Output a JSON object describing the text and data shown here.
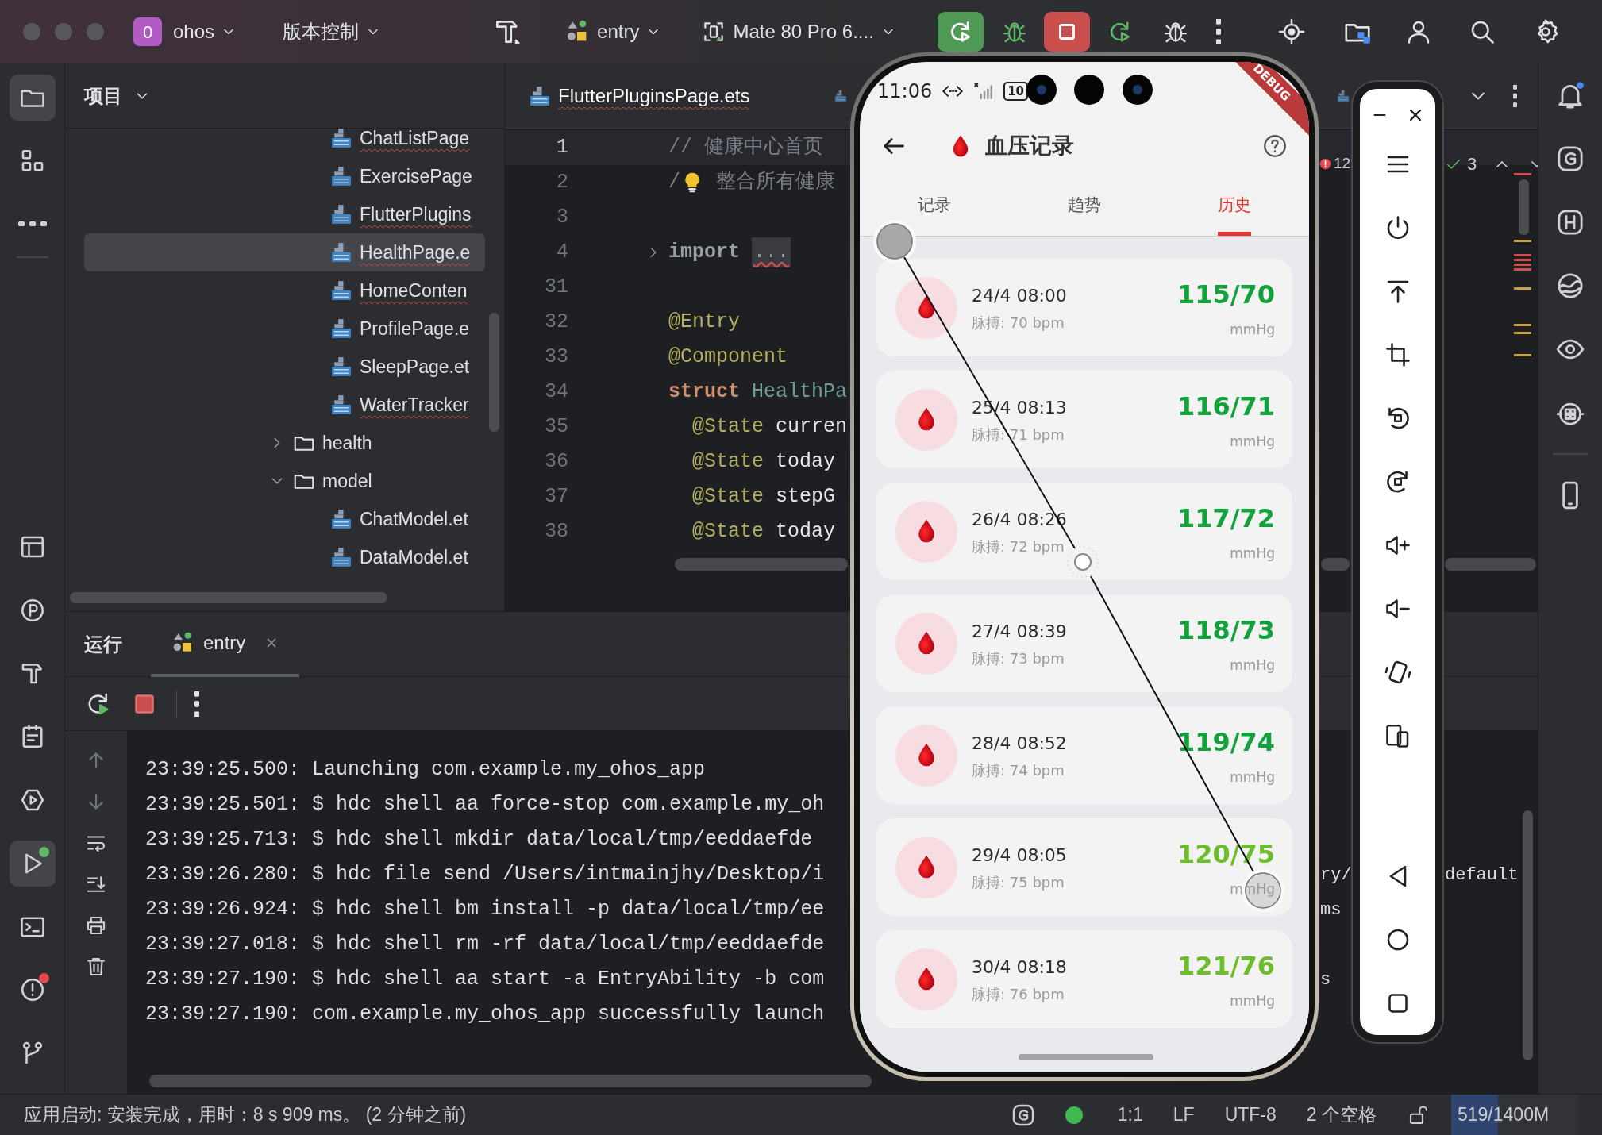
{
  "title_bar": {
    "project_badge": "0",
    "project": "ohos",
    "vcs": "版本控制",
    "run_config": "entry",
    "device": "Mate 80 Pro 6...."
  },
  "tool_strip": {
    "top": [
      {
        "kind": "folder",
        "selected": true
      },
      {
        "kind": "grid",
        "selected": false
      },
      {
        "kind": "dots",
        "selected": false
      }
    ],
    "bottom": [
      {
        "kind": "table",
        "selected": false
      },
      {
        "kind": "circle-p",
        "selected": false
      },
      {
        "kind": "hammer",
        "selected": false
      },
      {
        "kind": "clipboard",
        "selected": false
      },
      {
        "kind": "hex-play",
        "selected": false
      },
      {
        "kind": "play",
        "selected": true,
        "color": "#5fb865"
      },
      {
        "kind": "terminal",
        "selected": false
      },
      {
        "kind": "alert",
        "selected": false,
        "color": "#e5484d"
      },
      {
        "kind": "branch",
        "selected": false
      }
    ]
  },
  "project_panel": {
    "title": "项目",
    "tree": [
      {
        "kind": "file",
        "name": "ChatListPage",
        "has_error": true,
        "selected": false
      },
      {
        "kind": "file",
        "name": "ExercisePage",
        "has_error": false,
        "selected": false
      },
      {
        "kind": "file",
        "name": "FlutterPlugins",
        "has_error": true,
        "selected": false
      },
      {
        "kind": "file",
        "name": "HealthPage.e",
        "has_error": true,
        "selected": true
      },
      {
        "kind": "file",
        "name": "HomeConten",
        "has_error": true,
        "selected": false
      },
      {
        "kind": "file",
        "name": "ProfilePage.e",
        "has_error": false,
        "selected": false
      },
      {
        "kind": "file",
        "name": "SleepPage.et",
        "has_error": false,
        "selected": false
      },
      {
        "kind": "file",
        "name": "WaterTracker",
        "has_error": true,
        "selected": false
      },
      {
        "kind": "folder",
        "name": "health",
        "expanded": false,
        "selected": false
      },
      {
        "kind": "folder",
        "name": "model",
        "expanded": true,
        "selected": false,
        "children": [
          {
            "kind": "file",
            "name": "ChatModel.et",
            "has_error": false,
            "selected": false
          },
          {
            "kind": "file",
            "name": "DataModel.et",
            "has_error": false,
            "selected": false
          }
        ]
      }
    ]
  },
  "editor": {
    "tabs": [
      {
        "label": "FlutterPluginsPage.ets",
        "selected": true,
        "has_error": true
      },
      {
        "selected": false
      },
      {
        "selected": false
      }
    ],
    "problems": {
      "errors": "12",
      "passed": "3"
    },
    "lines": [
      {
        "number": "1",
        "current": true,
        "tokens": [
          {
            "kind": "comment",
            "text": "// 健康中心首页"
          }
        ]
      },
      {
        "number": "2",
        "current": false,
        "tokens": [
          {
            "kind": "comment",
            "text": "/"
          },
          {
            "kind": "bulb"
          },
          {
            "kind": "comment",
            "text": " 整合所有健康"
          }
        ]
      },
      {
        "number": "3",
        "current": false
      },
      {
        "number": "4",
        "current": false,
        "fold": true,
        "tokens": [
          {
            "kind": "import",
            "text": "import"
          },
          {
            "kind": "folded",
            "text": "..."
          }
        ]
      },
      {
        "number": "31",
        "current": false
      },
      {
        "number": "32",
        "current": false,
        "tokens": [
          {
            "kind": "annotation",
            "text": "@Entry"
          }
        ]
      },
      {
        "number": "33",
        "current": false,
        "tokens": [
          {
            "kind": "annotation",
            "text": "@Component"
          }
        ]
      },
      {
        "number": "34",
        "current": false,
        "tokens": [
          {
            "kind": "keyword",
            "text": "struct"
          },
          {
            "kind": "type",
            "text": " HealthPa"
          }
        ]
      },
      {
        "number": "35",
        "current": false,
        "tokens": [
          {
            "kind": "annotation",
            "text": "  @State"
          },
          {
            "kind": "plain",
            "text": " curren"
          }
        ]
      },
      {
        "number": "36",
        "current": false,
        "tokens": [
          {
            "kind": "annotation",
            "text": "  @State"
          },
          {
            "kind": "plain",
            "text": " today"
          }
        ]
      },
      {
        "number": "37",
        "current": false,
        "tokens": [
          {
            "kind": "annotation",
            "text": "  @State"
          },
          {
            "kind": "plain",
            "text": " stepG"
          }
        ]
      },
      {
        "number": "38",
        "current": false,
        "tokens": [
          {
            "kind": "annotation",
            "text": "  @State"
          },
          {
            "kind": "plain",
            "text": " today"
          }
        ]
      }
    ]
  },
  "run_panel": {
    "title": "运行",
    "tabs": [
      {
        "label": "entry",
        "selected": true
      }
    ],
    "lines": [
      {
        "text": "23:39:25.500: Launching com.example.my_ohos_app"
      },
      {
        "text": "23:39:25.501: $ hdc shell aa force-stop com.example.my_oh"
      },
      {
        "text": "23:39:25.713: $ hdc shell mkdir data/local/tmp/eeddaefde"
      },
      {
        "text": "23:39:26.280: $ hdc file send /Users/intmainjhy/Desktop/i",
        "tails": [
          "ry/",
          "default"
        ]
      },
      {
        "text": "23:39:26.924: $ hdc shell bm install -p data/local/tmp/ee",
        "tails": [
          "ms"
        ]
      },
      {
        "text": "23:39:27.018: $ hdc shell rm -rf data/local/tmp/eeddaefde"
      },
      {
        "text": "23:39:27.190: $ hdc shell aa start -a EntryAbility -b com",
        "tails": [
          "s"
        ]
      },
      {
        "text": "23:39:27.190: com.example.my_ohos_app successfully launch"
      }
    ]
  },
  "phone": {
    "time": "11:06",
    "battery": "10",
    "debug_label": "DEBUG",
    "title": "血压记录",
    "tabs": [
      {
        "label": "记录",
        "selected": false
      },
      {
        "label": "趋势",
        "selected": false
      },
      {
        "label": "历史",
        "selected": true
      }
    ],
    "records": [
      {
        "date": "24/4 08:00",
        "pulse": "脉搏: 70 bpm",
        "reading": "115/70",
        "unit": "mmHg",
        "color": "#12a23b"
      },
      {
        "date": "25/4 08:13",
        "pulse": "脉搏: 71 bpm",
        "reading": "116/71",
        "unit": "mmHg",
        "color": "#12a23b"
      },
      {
        "date": "26/4 08:26",
        "pulse": "脉搏: 72 bpm",
        "reading": "117/72",
        "unit": "mmHg",
        "color": "#12a23b"
      },
      {
        "date": "27/4 08:39",
        "pulse": "脉搏: 73 bpm",
        "reading": "118/73",
        "unit": "mmHg",
        "color": "#12a23b"
      },
      {
        "date": "28/4 08:52",
        "pulse": "脉搏: 74 bpm",
        "reading": "119/74",
        "unit": "mmHg",
        "color": "#12a23b"
      },
      {
        "date": "29/4 08:05",
        "pulse": "脉搏: 75 bpm",
        "reading": "120/75",
        "unit": "mmHg",
        "color": "#6cbd2a"
      },
      {
        "date": "30/4 08:18",
        "pulse": "脉搏: 76 bpm",
        "reading": "121/76",
        "unit": "mmHg",
        "color": "#6cbd2a"
      }
    ]
  },
  "status_bar": {
    "message": "应用启动: 安装完成，用时：8 s 909 ms。 (2 分钟之前)",
    "position": "1:1",
    "line_separator": "LF",
    "encoding": "UTF-8",
    "indent": "2 个空格",
    "memory": {
      "text": "519/1400M",
      "level": 0.37
    }
  }
}
